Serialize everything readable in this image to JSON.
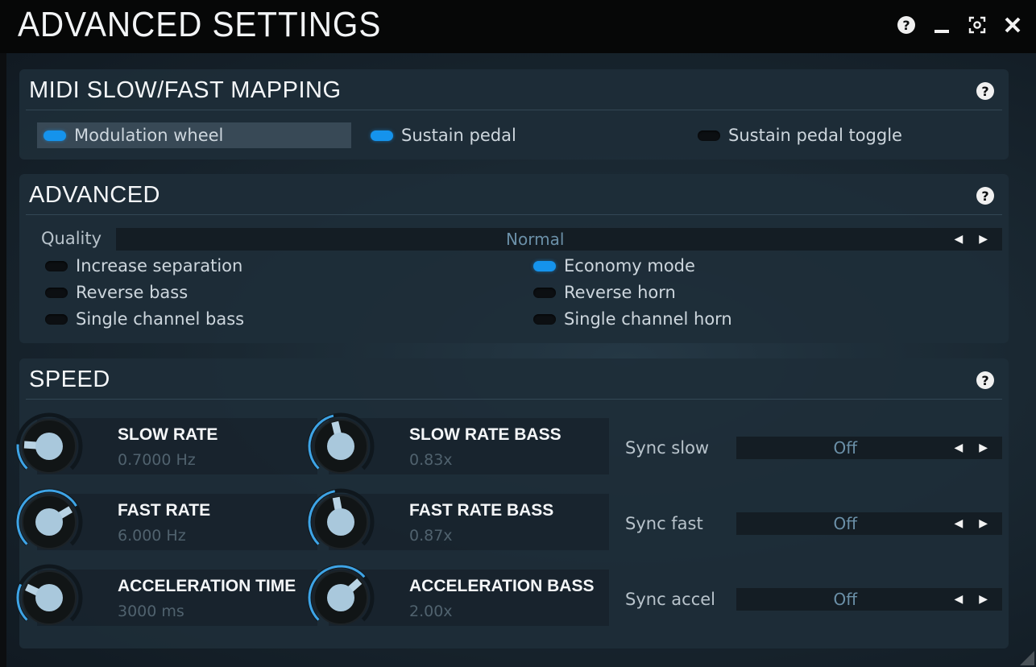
{
  "window": {
    "title": "ADVANCED SETTINGS",
    "help": "?",
    "minimize": "_",
    "maximize": "[o]",
    "close": "✕"
  },
  "midi": {
    "title": "MIDI SLOW/FAST MAPPING",
    "help": "?",
    "toggles": [
      {
        "label": "Modulation wheel",
        "on": true
      },
      {
        "label": "Sustain pedal",
        "on": true
      },
      {
        "label": "Sustain pedal toggle",
        "on": false
      }
    ]
  },
  "advanced": {
    "title": "ADVANCED",
    "help": "?",
    "quality_label": "Quality",
    "quality_value": "Normal",
    "toggles": [
      {
        "label": "Increase separation",
        "on": false
      },
      {
        "label": "Economy mode",
        "on": true
      },
      {
        "label": "Reverse bass",
        "on": false
      },
      {
        "label": "Reverse horn",
        "on": false
      },
      {
        "label": "Single channel bass",
        "on": false
      },
      {
        "label": "Single channel horn",
        "on": false
      }
    ]
  },
  "speed": {
    "title": "SPEED",
    "help": "?",
    "knobs": [
      {
        "name": "SLOW RATE",
        "value": "0.7000 Hz",
        "level": 0.18
      },
      {
        "name": "SLOW RATE BASS",
        "value": "0.83x",
        "level": 0.45
      },
      {
        "name": "FAST RATE",
        "value": "6.000 Hz",
        "level": 0.72
      },
      {
        "name": "FAST RATE BASS",
        "value": "0.87x",
        "level": 0.46
      },
      {
        "name": "ACCELERATION TIME",
        "value": "3000 ms",
        "level": 0.26
      },
      {
        "name": "ACCELERATION BASS",
        "value": "2.00x",
        "level": 0.68
      }
    ],
    "syncs": [
      {
        "label": "Sync slow",
        "value": "Off"
      },
      {
        "label": "Sync fast",
        "value": "Off"
      },
      {
        "label": "Sync accel",
        "value": "Off"
      }
    ]
  },
  "colors": {
    "accent": "#1593ec",
    "knob_cap": "#a9c8dc",
    "knob_arc": "#3ea4e6"
  },
  "icons": {
    "help": "help-icon",
    "minimize": "minimize-icon",
    "maximize": "maximize-icon",
    "close": "close-icon",
    "prev": "arrow-left-icon",
    "next": "arrow-right-icon"
  }
}
